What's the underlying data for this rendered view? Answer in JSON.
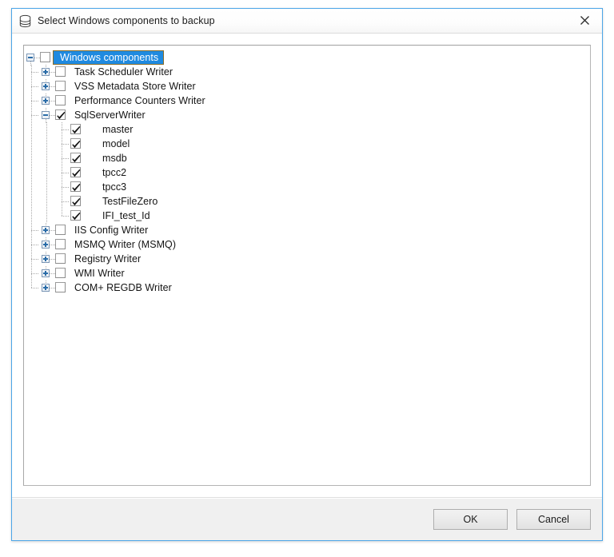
{
  "window": {
    "title": "Select Windows components to backup",
    "icon": "database-icon",
    "close_label": "×",
    "accent_border": "#4ca6e8"
  },
  "tree": {
    "root": {
      "label": "Windows components",
      "selected": true,
      "expanded": true,
      "checked": false
    },
    "items": [
      {
        "label": "Task Scheduler Writer",
        "checked": false,
        "expandable": true,
        "expanded": false
      },
      {
        "label": "VSS Metadata Store Writer",
        "checked": false,
        "expandable": true,
        "expanded": false
      },
      {
        "label": "Performance Counters Writer",
        "checked": false,
        "expandable": true,
        "expanded": false
      },
      {
        "label": "SqlServerWriter",
        "checked": true,
        "expandable": true,
        "expanded": true,
        "children": [
          {
            "label": "master",
            "checked": true
          },
          {
            "label": "model",
            "checked": true
          },
          {
            "label": "msdb",
            "checked": true
          },
          {
            "label": "tpcc2",
            "checked": true
          },
          {
            "label": "tpcc3",
            "checked": true
          },
          {
            "label": "TestFileZero",
            "checked": true
          },
          {
            "label": "IFI_test_Id",
            "checked": true
          }
        ]
      },
      {
        "label": "IIS Config Writer",
        "checked": false,
        "expandable": true,
        "expanded": false
      },
      {
        "label": "MSMQ Writer (MSMQ)",
        "checked": false,
        "expandable": true,
        "expanded": false
      },
      {
        "label": "Registry Writer",
        "checked": false,
        "expandable": true,
        "expanded": false
      },
      {
        "label": "WMI Writer",
        "checked": false,
        "expandable": true,
        "expanded": false
      },
      {
        "label": "COM+ REGDB Writer",
        "checked": false,
        "expandable": true,
        "expanded": false
      }
    ]
  },
  "footer": {
    "ok_label": "OK",
    "cancel_label": "Cancel"
  }
}
